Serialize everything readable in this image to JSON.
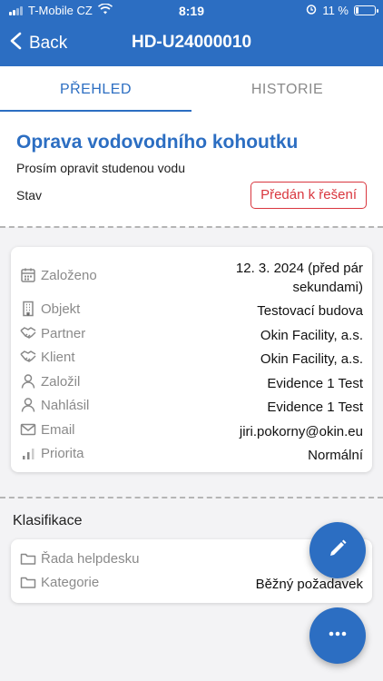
{
  "status_bar": {
    "carrier": "T-Mobile CZ",
    "time": "8:19",
    "battery": "11 %"
  },
  "nav": {
    "back_label": "Back",
    "title": "HD-U24000010"
  },
  "tabs": [
    {
      "label": "PŘEHLED",
      "active": true
    },
    {
      "label": "HISTORIE",
      "active": false
    }
  ],
  "header": {
    "title": "Oprava vodovodního kohoutku",
    "description": "Prosím opravit studenou vodu",
    "status_label": "Stav",
    "status_value": "Předán k řešení"
  },
  "details": [
    {
      "icon": "calendar-icon",
      "label": "Založeno",
      "value_line1": "12. 3. 2024 (před pár",
      "value_line2": "sekundami)"
    },
    {
      "icon": "building-icon",
      "label": "Objekt",
      "value": "Testovací budova"
    },
    {
      "icon": "handshake-icon",
      "label": "Partner",
      "value": "Okin Facility, a.s."
    },
    {
      "icon": "handshake-icon",
      "label": "Klient",
      "value": "Okin Facility, a.s."
    },
    {
      "icon": "person-icon",
      "label": "Založil",
      "value": "Evidence 1 Test"
    },
    {
      "icon": "person-icon",
      "label": "Nahlásil",
      "value": "Evidence 1 Test"
    },
    {
      "icon": "envelope-icon",
      "label": "Email",
      "value": "jiri.pokorny@okin.eu"
    },
    {
      "icon": "signal-icon",
      "label": "Priorita",
      "value": "Normální"
    }
  ],
  "classification": {
    "title": "Klasifikace",
    "rows": [
      {
        "icon": "folder-icon",
        "label": "Řada helpdesku",
        "value": "U"
      },
      {
        "icon": "folder-icon",
        "label": "Kategorie",
        "value": "Běžný požadavek"
      }
    ]
  },
  "fabs": [
    {
      "icon": "pencil-icon"
    },
    {
      "icon": "more-icon"
    }
  ],
  "colors": {
    "brand": "#2c6ec2",
    "status_red": "#d9363e"
  }
}
